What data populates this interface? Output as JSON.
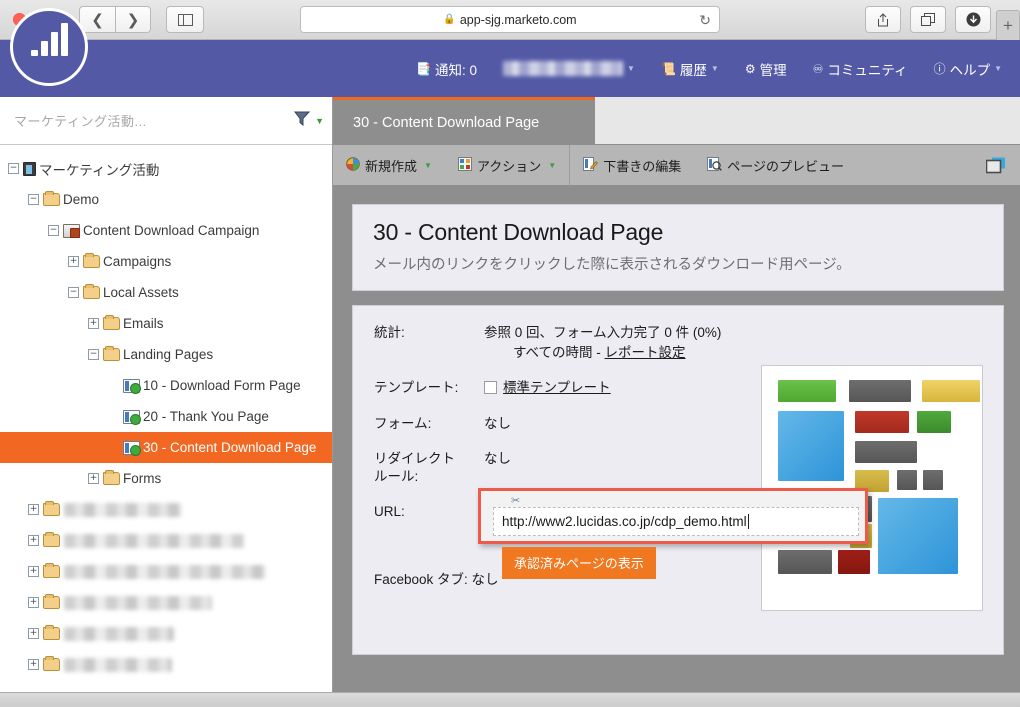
{
  "browser": {
    "url": "app-sjg.marketo.com",
    "lock_icon": "lock-icon",
    "reload_icon": "reload-icon",
    "back_icon": "chevron-left-icon",
    "forward_icon": "chevron-right-icon",
    "sidebar_icon": "sidebar-toggle-icon",
    "share_icon": "share-icon",
    "tabs_icon": "show-tabs-icon",
    "download_icon": "download-icon",
    "newtab_label": "+"
  },
  "header": {
    "logo_name": "marketo-logo",
    "nav": [
      {
        "label": "通知: 0",
        "icon": "notification-icon",
        "caret": false
      },
      {
        "label": "",
        "icon": "",
        "caret": true,
        "blurred": true
      },
      {
        "label": "履歴",
        "icon": "history-icon",
        "caret": true
      },
      {
        "label": "管理",
        "icon": "gear-icon",
        "caret": false
      },
      {
        "label": "コミュニティ",
        "icon": "community-icon",
        "caret": false
      },
      {
        "label": "ヘルプ",
        "icon": "help-icon",
        "caret": true
      }
    ]
  },
  "sidebar": {
    "search_placeholder": "マーケティング活動...",
    "filter_icon": "funnel-icon",
    "tree": [
      {
        "label": "マーケティング活動",
        "depth": 0,
        "twisty": "−",
        "icon": "root-icon",
        "selected": false,
        "blurred": false
      },
      {
        "label": "Demo",
        "depth": 1,
        "twisty": "−",
        "icon": "folder-icon",
        "selected": false,
        "blurred": false
      },
      {
        "label": "Content Download Campaign",
        "depth": 2,
        "twisty": "−",
        "icon": "program-icon",
        "selected": false,
        "blurred": false
      },
      {
        "label": "Campaigns",
        "depth": 3,
        "twisty": "+",
        "icon": "folder-icon",
        "selected": false,
        "blurred": false
      },
      {
        "label": "Local Assets",
        "depth": 3,
        "twisty": "−",
        "icon": "folder-icon",
        "selected": false,
        "blurred": false
      },
      {
        "label": "Emails",
        "depth": 4,
        "twisty": "+",
        "icon": "folder-icon",
        "selected": false,
        "blurred": false
      },
      {
        "label": "Landing Pages",
        "depth": 4,
        "twisty": "−",
        "icon": "folder-icon",
        "selected": false,
        "blurred": false
      },
      {
        "label": "10 - Download Form Page",
        "depth": 5,
        "twisty": "",
        "icon": "landing-page-icon",
        "selected": false,
        "blurred": false
      },
      {
        "label": "20 - Thank You Page",
        "depth": 5,
        "twisty": "",
        "icon": "landing-page-icon",
        "selected": false,
        "blurred": false
      },
      {
        "label": "30 - Content Download Page",
        "depth": 5,
        "twisty": "",
        "icon": "landing-page-icon",
        "selected": true,
        "blurred": false
      },
      {
        "label": "Forms",
        "depth": 4,
        "twisty": "+",
        "icon": "folder-icon",
        "selected": false,
        "blurred": false
      },
      {
        "label": "",
        "depth": 1,
        "twisty": "+",
        "icon": "folder-icon",
        "selected": false,
        "blurred": true,
        "blur_w": 118
      },
      {
        "label": "",
        "depth": 1,
        "twisty": "+",
        "icon": "folder-icon",
        "selected": false,
        "blurred": true,
        "blur_w": 180
      },
      {
        "label": "",
        "depth": 1,
        "twisty": "+",
        "icon": "folder-icon",
        "selected": false,
        "blurred": true,
        "blur_w": 202
      },
      {
        "label": "",
        "depth": 1,
        "twisty": "+",
        "icon": "folder-icon",
        "selected": false,
        "blurred": true,
        "blur_w": 148
      },
      {
        "label": "",
        "depth": 1,
        "twisty": "+",
        "icon": "folder-icon",
        "selected": false,
        "blurred": true,
        "blur_w": 110
      },
      {
        "label": "",
        "depth": 1,
        "twisty": "+",
        "icon": "folder-icon",
        "selected": false,
        "blurred": true,
        "blur_w": 108
      }
    ]
  },
  "workspace": {
    "tab_label": "30 - Content Download Page",
    "toolbar": [
      {
        "label": "新規作成",
        "icon": "new-icon",
        "caret": true,
        "group": 1
      },
      {
        "label": "アクション",
        "icon": "actions-icon",
        "caret": true,
        "group": 1
      },
      {
        "label": "下書きの編集",
        "icon": "edit-draft-icon",
        "caret": false,
        "group": 2
      },
      {
        "label": "ページのプレビュー",
        "icon": "preview-page-icon",
        "caret": false,
        "group": 2
      }
    ],
    "toolbar_right_icon": "window-panel-icon"
  },
  "page": {
    "title": "30 - Content Download Page",
    "description": "メール内のリンクをクリックした際に表示されるダウンロード用ページ。",
    "fields": {
      "stats_label": "統計:",
      "stats_line1": "参照 0 回、フォーム入力完了 0 件 (0%)",
      "stats_line2_prefix": "すべての時間 - ",
      "stats_link": "レポート設定",
      "template_label": "テンプレート:",
      "template_value": "標準テンプレート",
      "form_label": "フォーム:",
      "form_value": "なし",
      "redirect_label_l1": "リダイレクト",
      "redirect_label_l2": "ルール:",
      "redirect_value": "なし",
      "url_label": "URL:",
      "url_value": "http://www2.lucidas.co.jp/cdp_demo.html",
      "view_button": "承認済みページの表示",
      "facebook_row": "Facebook タブ: なし"
    },
    "thumbnail_name": "landing-page-thumbnail"
  },
  "colors": {
    "brand_purple": "#5359a5",
    "accent_orange": "#f26722",
    "button_orange": "#f07820",
    "highlight_red": "#ef5b49",
    "card_bg": "#edecf2",
    "workspace_gray": "#8e8e8e"
  }
}
